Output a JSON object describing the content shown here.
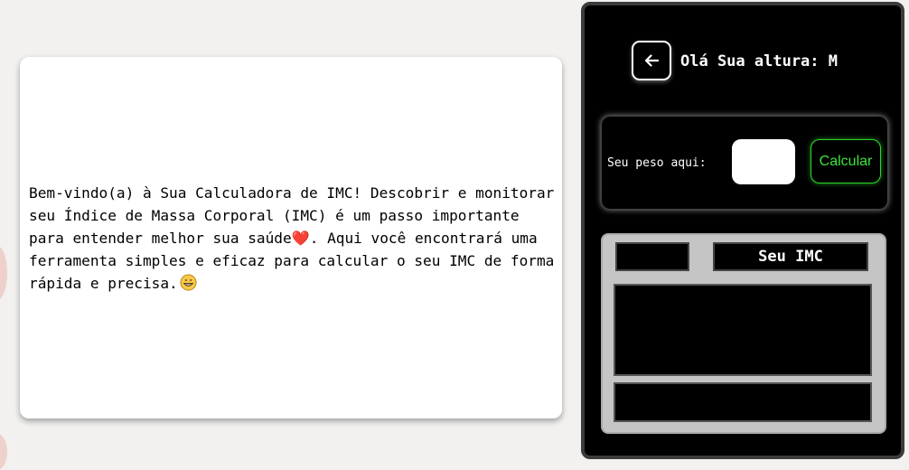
{
  "welcome": {
    "text": "Bem-vindo(a) à Sua Calculadora de IMC! Descobrir e monitorar seu Índice de Massa Corporal (IMC) é um passo importante para entender melhor sua saúde❤️. Aqui você encontrará uma ferramenta simples e eficaz para calcular o seu IMC de forma rápida e precisa.",
    "end_icon": "grinning-face-emoji"
  },
  "header": {
    "back_icon": "arrow-left-icon",
    "greeting": "Olá Sua altura: M"
  },
  "weight": {
    "label": "Seu peso aqui:",
    "input_value": "",
    "calculate_label": "Calcular"
  },
  "result": {
    "title": "Seu IMC",
    "value": "",
    "classification": ""
  },
  "colors": {
    "accent_green": "#3ee43e",
    "panel_bg": "#000000",
    "result_frame": "#c5c5c5"
  }
}
